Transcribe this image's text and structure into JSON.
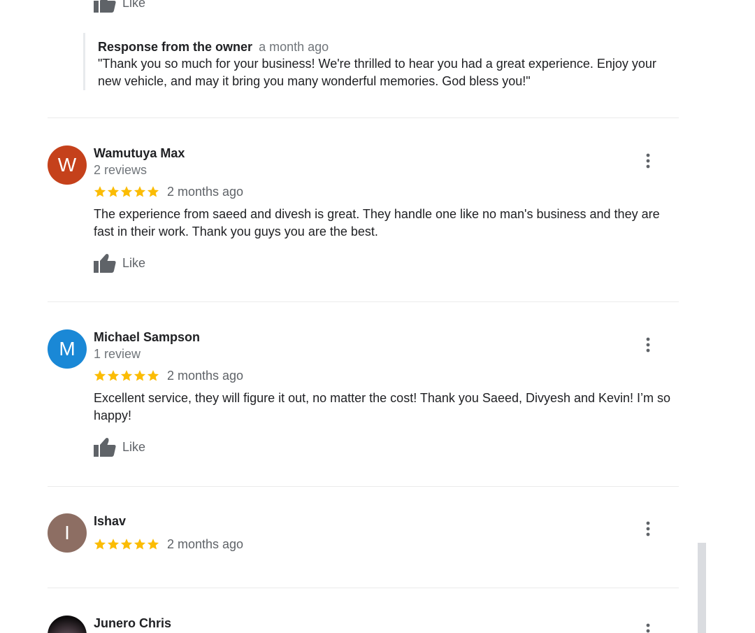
{
  "top_like": {
    "label": "Like"
  },
  "owner_response": {
    "title": "Response from the owner",
    "time": "a month ago",
    "text_line1": "\"Thank you so much for your business! We're thrilled to hear you had a great experience. Enjoy your",
    "text_line2": "new vehicle, and may it bring you many wonderful memories. God bless you!\""
  },
  "reviews": [
    {
      "initial": "W",
      "avatar_color": "#c5411b",
      "name": "Wamutuya Max",
      "count": "2 reviews",
      "stars": 5,
      "time": "2 months ago",
      "text_line1": "The experience from saeed and divesh is great. They handle one like no man's business and they are",
      "text_line2": "fast in their work. Thank you guys you are the best.",
      "like_label": "Like"
    },
    {
      "initial": "M",
      "avatar_color": "#1a88d6",
      "name": "Michael Sampson",
      "count": "1 review",
      "stars": 5,
      "time": "2 months ago",
      "text_line1": "Excellent service, they will figure it out, no matter the cost! Thank you Saeed, Divyesh and Kevin! I’m so",
      "text_line2": "happy!",
      "like_label": "Like"
    },
    {
      "initial": "I",
      "avatar_color": "#8d6e63",
      "name": "Ishav",
      "stars": 5,
      "time": "2 months ago"
    },
    {
      "name": "Junero Chris"
    }
  ],
  "colors": {
    "star": "#fbbc04",
    "icon_gray": "#5f6368",
    "divider": "#ebebeb"
  },
  "icons": {
    "like": "thumbs-up-icon",
    "star": "star-icon",
    "more": "more-vert-icon"
  }
}
